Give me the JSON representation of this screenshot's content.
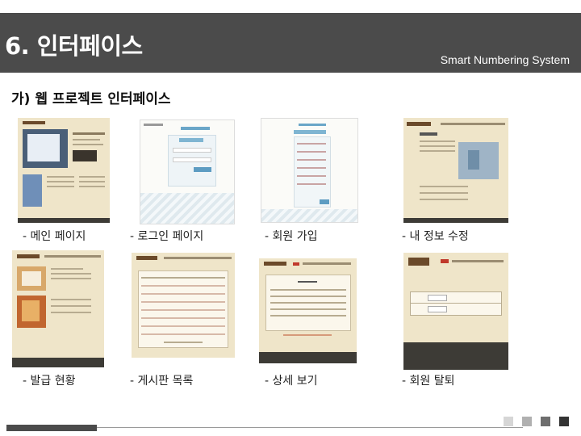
{
  "header": {
    "title": "6. 인터페이스",
    "brand": "Smart Numbering System"
  },
  "section": {
    "title": "가) 웹 프로젝트 인터페이스"
  },
  "screens": [
    {
      "caption": "- 메인 페이지"
    },
    {
      "caption": "- 로그인 페이지"
    },
    {
      "caption": "- 회원 가입"
    },
    {
      "caption": "- 내 정보 수정"
    },
    {
      "caption": "- 발급 현황"
    },
    {
      "caption": "- 게시판 목록"
    },
    {
      "caption": "- 상세 보기"
    },
    {
      "caption": "- 회원 탈퇴"
    }
  ],
  "colors": {
    "header_bg": "#4b4b4b",
    "beige": "#efe5c9",
    "dark_bar": "#3d3b36"
  }
}
